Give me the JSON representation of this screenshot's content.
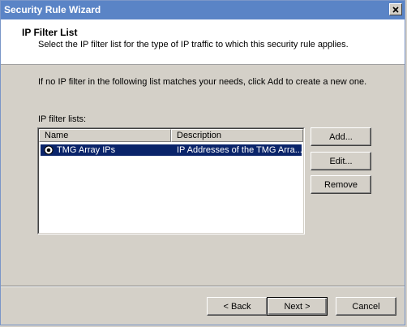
{
  "window": {
    "title": "Security Rule Wizard",
    "close_glyph": "×"
  },
  "header": {
    "title": "IP Filter List",
    "subtitle": "Select the IP filter list for the type of IP traffic to which this security rule applies."
  },
  "body": {
    "instruction": "If no IP filter in the following list matches your needs, click Add to create a new one.",
    "list_label": "IP filter lists:"
  },
  "filter_list": {
    "columns": [
      "Name",
      "Description"
    ],
    "rows": [
      {
        "name": "TMG Array IPs",
        "description": "IP Addresses of the TMG Arra...",
        "selected": true
      }
    ]
  },
  "side_buttons": {
    "add": "Add...",
    "edit": "Edit...",
    "remove": "Remove"
  },
  "footer_buttons": {
    "back": "< Back",
    "next": "Next >",
    "cancel": "Cancel"
  },
  "colors": {
    "title_bar": "#5a84c6",
    "selection": "#0a246a",
    "dialog_face": "#d4d0c8"
  }
}
